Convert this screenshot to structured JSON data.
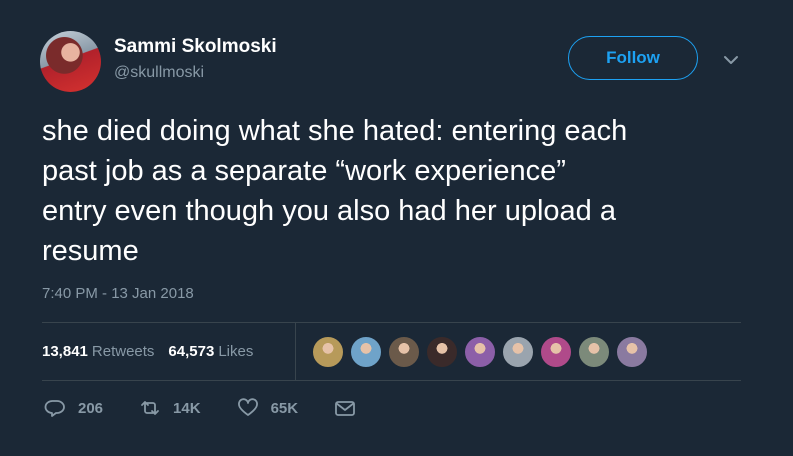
{
  "author": {
    "name": "Sammi Skolmoski",
    "handle": "@skullmoski",
    "avatar_icon": "user-avatar"
  },
  "follow_button": {
    "label": "Follow"
  },
  "menu": {
    "icon": "chevron-down-icon"
  },
  "tweet": {
    "text": "she died doing what she hated: entering each\npast job as a separate “work experience”\nentry even though you also had her upload a\nresume",
    "timestamp": "7:40 PM - 13 Jan 2018"
  },
  "stats": {
    "retweets_count": "13,841",
    "retweets_label": "Retweets",
    "likes_count": "64,573",
    "likes_label": "Likes"
  },
  "likers": [
    {
      "name": "liker-avatar-1",
      "color": "#b79a5a"
    },
    {
      "name": "liker-avatar-2",
      "color": "#6fa3c9"
    },
    {
      "name": "liker-avatar-3",
      "color": "#6b5a4a"
    },
    {
      "name": "liker-avatar-4",
      "color": "#3a2a2a"
    },
    {
      "name": "liker-avatar-5",
      "color": "#8c5fa8"
    },
    {
      "name": "liker-avatar-6",
      "color": "#9aa4ae"
    },
    {
      "name": "liker-avatar-7",
      "color": "#b04a8a"
    },
    {
      "name": "liker-avatar-8",
      "color": "#7c8a7a"
    },
    {
      "name": "liker-avatar-9",
      "color": "#8a7aa0"
    }
  ],
  "actions": {
    "reply_count": "206",
    "retweet_count": "14K",
    "like_count": "65K"
  },
  "colors": {
    "background": "#1b2836",
    "accent": "#1da1f2",
    "muted": "#8899a6",
    "divider": "#38444d"
  }
}
